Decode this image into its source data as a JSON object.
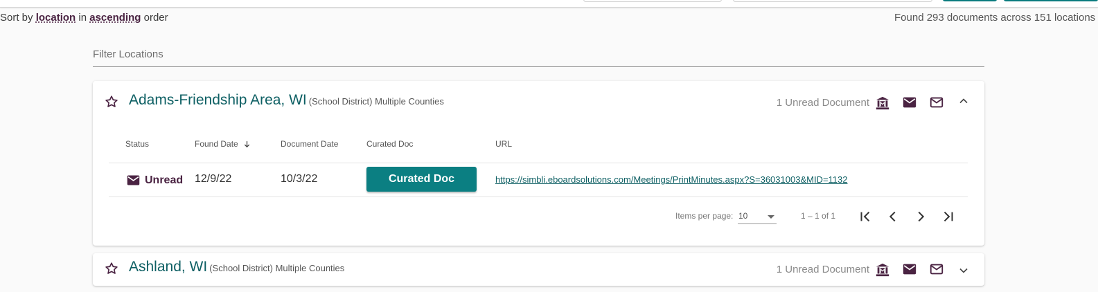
{
  "sort": {
    "prefix": "Sort by",
    "field": "location",
    "middle": "in",
    "direction": "ascending",
    "suffix": "order"
  },
  "summary": "Found 293 documents across 151 locations",
  "filter": {
    "placeholder": "Filter Locations"
  },
  "locations": [
    {
      "name": "Adams-Friendship Area, WI",
      "subtitle": "(School District) Multiple Counties",
      "unread_count": "1 Unread Document",
      "expanded": true,
      "table": {
        "headers": [
          "Status",
          "Found Date",
          "Document Date",
          "Curated Doc",
          "URL"
        ],
        "rows": [
          {
            "status": "Unread",
            "found_date": "12/9/22",
            "document_date": "10/3/22",
            "curated_label": "Curated Doc",
            "url": "https://simbli.eboardsolutions.com/Meetings/PrintMinutes.aspx?S=36031003&MID=1132"
          }
        ]
      },
      "paginator": {
        "items_label": "Items per page:",
        "page_size": "10",
        "range": "1 – 1 of 1"
      }
    },
    {
      "name": "Ashland, WI",
      "subtitle": "(School District) Multiple Counties",
      "unread_count": "1 Unread Document",
      "expanded": false
    }
  ],
  "icons": [
    "star-outline-icon",
    "municipal-building-icon",
    "mail-filled-icon",
    "mail-outline-icon",
    "chevron-up-icon",
    "chevron-down-icon",
    "arrow-down-icon",
    "first-page-icon",
    "previous-page-icon",
    "next-page-icon",
    "last-page-icon"
  ],
  "colors": {
    "teal": "#0b7f82",
    "plum": "#4a2342",
    "title_teal": "#0d5f63"
  }
}
